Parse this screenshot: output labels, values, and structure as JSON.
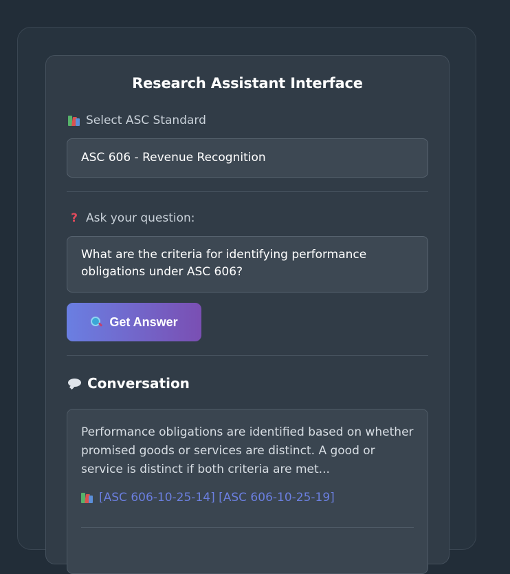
{
  "app": {
    "title": "Research Assistant Interface"
  },
  "standard": {
    "label": "Select ASC Standard",
    "icon": "books-icon",
    "selected": "ASC 606 - Revenue Recognition"
  },
  "question": {
    "label": "Ask your question:",
    "icon": "question-mark-icon",
    "value": "What are the criteria for identifying performance obligations under ASC 606?"
  },
  "submit": {
    "label": "Get Answer",
    "icon": "magnifying-glass-icon"
  },
  "conversation": {
    "heading": "Conversation",
    "icon": "speech-bubble-icon",
    "messages": [
      {
        "text": "Performance obligations are identified based on whether promised goods or services are distinct. A good or service is distinct if both criteria are met...",
        "citations": "[ASC 606-10-25-14] [ASC 606-10-25-19]",
        "citation_icon": "books-icon"
      }
    ]
  },
  "colors": {
    "background": "#222d38",
    "card": "#313c47",
    "button_gradient_start": "#6a7fe2",
    "button_gradient_end": "#7a4fb3",
    "citation": "#6b7fe0"
  }
}
